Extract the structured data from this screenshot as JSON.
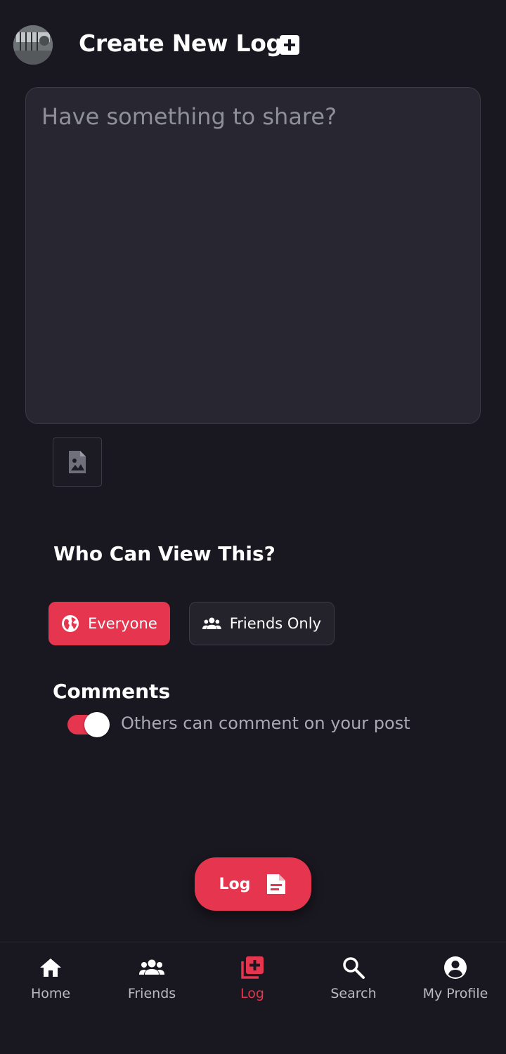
{
  "header": {
    "title": "Create New Log"
  },
  "composer": {
    "placeholder": "Have something to share?",
    "value": ""
  },
  "visibility": {
    "title": "Who Can View This?",
    "options": [
      {
        "label": "Everyone",
        "selected": true,
        "icon": "globe-icon"
      },
      {
        "label": "Friends Only",
        "selected": false,
        "icon": "group-icon"
      }
    ]
  },
  "comments": {
    "title": "Comments",
    "toggle_label": "Others can comment on your post",
    "enabled": true
  },
  "submit": {
    "label": "Log",
    "icon": "document-icon"
  },
  "nav": {
    "items": [
      {
        "label": "Home",
        "icon": "home-icon",
        "active": false
      },
      {
        "label": "Friends",
        "icon": "group-icon",
        "active": false
      },
      {
        "label": "Log",
        "icon": "add-log-icon",
        "active": true
      },
      {
        "label": "Search",
        "icon": "search-icon",
        "active": false
      },
      {
        "label": "My Profile",
        "icon": "account-icon",
        "active": false
      }
    ]
  },
  "colors": {
    "background": "#19171f",
    "accent": "#e6354e",
    "surface": "#282731",
    "muted_text": "#a8a9b4"
  }
}
